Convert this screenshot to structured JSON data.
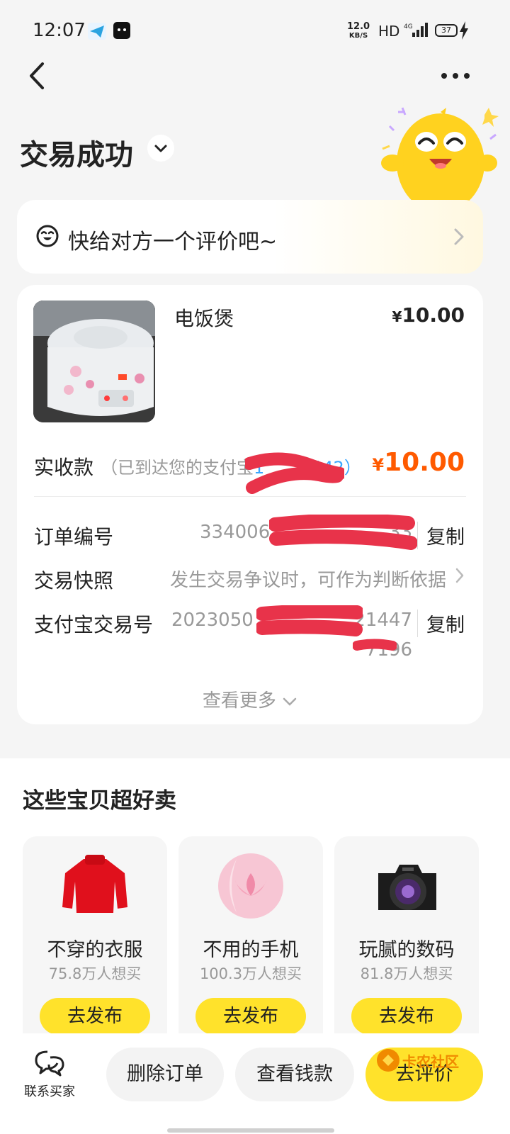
{
  "status_bar": {
    "time": "12:07",
    "net_speed": "12.0",
    "net_unit": "KB/S",
    "hd": "HD",
    "network": "4G",
    "battery": "37"
  },
  "header": {
    "title": "交易成功"
  },
  "review_prompt": {
    "text": "快给对方一个评价吧~"
  },
  "order": {
    "product_name": "电饭煲",
    "currency": "¥",
    "product_price": "10.00",
    "received_label": "实收款",
    "received_note_prefix": "（已到达您的支付宝",
    "received_note_account": "1",
    "received_note_suffix": "*42）",
    "received_amount": "10.00",
    "rows": [
      {
        "label": "订单编号",
        "value": "334006",
        "value_tail": "33",
        "action": "复制"
      },
      {
        "label": "交易快照",
        "value": "发生交易争议时，可作为判断依据"
      },
      {
        "label": "支付宝交易号",
        "value": "2023050",
        "value_tail": "21447",
        "value_line2": "7196",
        "action": "复制"
      }
    ],
    "more_label": "查看更多"
  },
  "recommend": {
    "title": "这些宝贝超好卖",
    "items": [
      {
        "name": "不穿的衣服",
        "count": "75.8万人想买",
        "button": "去发布",
        "icon": "red-sweater-icon"
      },
      {
        "name": "不用的手机",
        "count": "100.3万人想买",
        "button": "去发布",
        "icon": "pink-phone-icon"
      },
      {
        "name": "玩腻的数码",
        "count": "81.8万人想买",
        "button": "去发布",
        "icon": "camera-icon"
      }
    ]
  },
  "bottom_bar": {
    "contact_label": "联系买家",
    "delete_label": "删除订单",
    "view_money_label": "查看钱款",
    "review_label": "去评价",
    "watermark": "卡农社区"
  },
  "colors": {
    "accent_yellow": "#ffe22b",
    "price_orange": "#ff5a00",
    "link_blue": "#3aa6ff",
    "redaction_red": "#e8334a"
  }
}
